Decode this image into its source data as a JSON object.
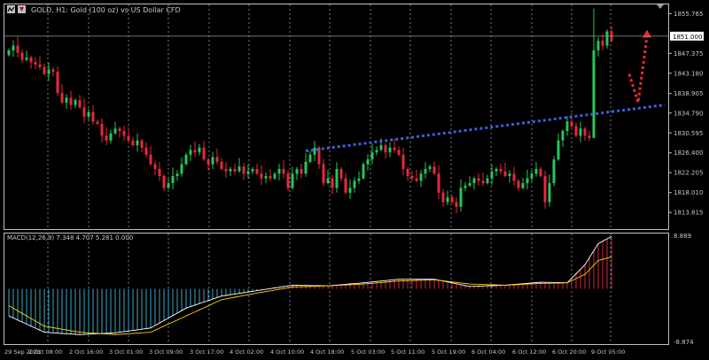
{
  "colors": {
    "background": "#000000",
    "frame": "#c0c0c0",
    "text": "#c8c8c8",
    "grid": "#ffffff",
    "bull": "#26c65a",
    "bear": "#e8283c",
    "trendline": "#3f5fdc",
    "arrow": "#e8283c",
    "macd_hist_pos": "#d0283c",
    "macd_hist_neg": "#3aa8c8",
    "macd_line": "#ffffff",
    "signal_line": "#ffd400",
    "price_label_bg": "#ffffff"
  },
  "header": {
    "symbol_line": "GOLD, H1:  Gold (100 oz) vs US Dollar CFD"
  },
  "current_price_label": "1851.000",
  "macd_label": "MACD(12,26,9) 7.348 4.707 5.281 0.000",
  "macd_scale": {
    "top": "8.889",
    "bottom": "-8.874"
  },
  "chart_data": [
    {
      "type": "candlestick",
      "title": "GOLD, H1:  Gold (100 oz) vs US Dollar CFD",
      "ylim": [
        1810.5,
        1857.5
      ],
      "y_ticks": [
        "1855.765",
        "1851.000",
        "1847.375",
        "1843.180",
        "1838.905",
        "1834.790",
        "1830.595",
        "1826.400",
        "1822.205",
        "1818.010",
        "1813.815"
      ],
      "x_ticks": [
        "29 Sep 2023",
        "2 Oct 08:00",
        "2 Oct 16:00",
        "3 Oct 01:00",
        "3 Oct 09:00",
        "3 Oct 17:00",
        "4 Oct 02:00",
        "4 Oct 10:00",
        "4 Oct 18:00",
        "5 Oct 03:00",
        "5 Oct 11:00",
        "5 Oct 19:00",
        "6 Oct 04:00",
        "6 Oct 12:00",
        "6 Oct 20:00",
        "9 Oct 05:00"
      ],
      "current_price": 1851.0,
      "closes": [
        1848.0,
        1849.0,
        1847.5,
        1846.0,
        1846.5,
        1845.5,
        1845.0,
        1844.5,
        1843.0,
        1844.0,
        1843.5,
        1839.0,
        1837.0,
        1838.0,
        1836.5,
        1837.5,
        1836.0,
        1834.0,
        1835.0,
        1833.0,
        1832.5,
        1830.0,
        1829.0,
        1830.5,
        1831.5,
        1831.0,
        1830.0,
        1829.0,
        1828.0,
        1829.0,
        1827.5,
        1826.0,
        1824.0,
        1823.0,
        1821.5,
        1819.0,
        1820.0,
        1821.5,
        1822.0,
        1824.0,
        1826.0,
        1827.0,
        1826.5,
        1827.5,
        1825.0,
        1824.0,
        1825.5,
        1824.5,
        1823.0,
        1822.5,
        1823.0,
        1822.5,
        1823.5,
        1822.0,
        1822.5,
        1823.0,
        1822.0,
        1821.0,
        1821.5,
        1821.0,
        1822.0,
        1823.0,
        1822.0,
        1819.0,
        1822.0,
        1823.0,
        1822.0,
        1824.5,
        1826.0,
        1827.5,
        1824.0,
        1820.0,
        1821.0,
        1819.0,
        1823.0,
        1821.0,
        1818.0,
        1819.0,
        1820.5,
        1821.0,
        1824.0,
        1825.0,
        1826.5,
        1827.0,
        1828.0,
        1826.5,
        1827.5,
        1827.0,
        1826.0,
        1823.0,
        1821.5,
        1821.0,
        1820.5,
        1822.0,
        1823.0,
        1823.5,
        1822.0,
        1818.0,
        1816.0,
        1817.0,
        1816.0,
        1815.0,
        1819.0,
        1819.5,
        1820.0,
        1821.0,
        1820.5,
        1820.0,
        1821.0,
        1822.5,
        1823.0,
        1822.5,
        1821.5,
        1822.0,
        1820.5,
        1819.0,
        1820.0,
        1821.0,
        1822.0,
        1823.0,
        1821.5,
        1816.0,
        1820.0,
        1825.0,
        1829.0,
        1831.0,
        1833.0,
        1832.0,
        1830.0,
        1831.5,
        1830.0,
        1829.5,
        1848.0,
        1850.0,
        1849.0,
        1852.0,
        1850.0
      ]
    },
    {
      "type": "line",
      "title": "MACD(12,26,9) 7.348 4.707 5.281 0.000",
      "ylim": [
        -8.874,
        8.889
      ],
      "series": [
        {
          "name": "MACD",
          "x": [
            0,
            8,
            16,
            24,
            32,
            40,
            48,
            56,
            64,
            72,
            80,
            88,
            96,
            104,
            112,
            120,
            126,
            130,
            133,
            136
          ],
          "values": [
            -4.5,
            -7.2,
            -7.6,
            -7.3,
            -6.5,
            -3.2,
            -1.2,
            -0.3,
            0.6,
            0.5,
            1.0,
            1.6,
            1.6,
            0.4,
            0.6,
            1.1,
            1.0,
            4.0,
            7.5,
            8.7
          ]
        },
        {
          "name": "Signal",
          "x": [
            0,
            8,
            16,
            24,
            32,
            40,
            48,
            56,
            64,
            72,
            80,
            88,
            96,
            104,
            112,
            120,
            126,
            130,
            133,
            136
          ],
          "values": [
            -2.8,
            -6.2,
            -7.2,
            -7.6,
            -7.2,
            -4.5,
            -1.8,
            -0.7,
            0.3,
            0.5,
            0.8,
            1.3,
            1.5,
            0.8,
            0.6,
            0.9,
            1.0,
            2.4,
            4.7,
            5.3
          ]
        }
      ]
    }
  ],
  "annotations": {
    "trendline": {
      "from": {
        "bar": 67,
        "price": 1826.8
      },
      "to": {
        "bar": 148,
        "price": 1836.5
      }
    },
    "arrow": {
      "from": {
        "bar": 140,
        "price": 1843.0
      },
      "via": {
        "bar": 142,
        "price": 1837.0
      },
      "to": {
        "bar": 144,
        "price": 1852.0
      }
    }
  }
}
